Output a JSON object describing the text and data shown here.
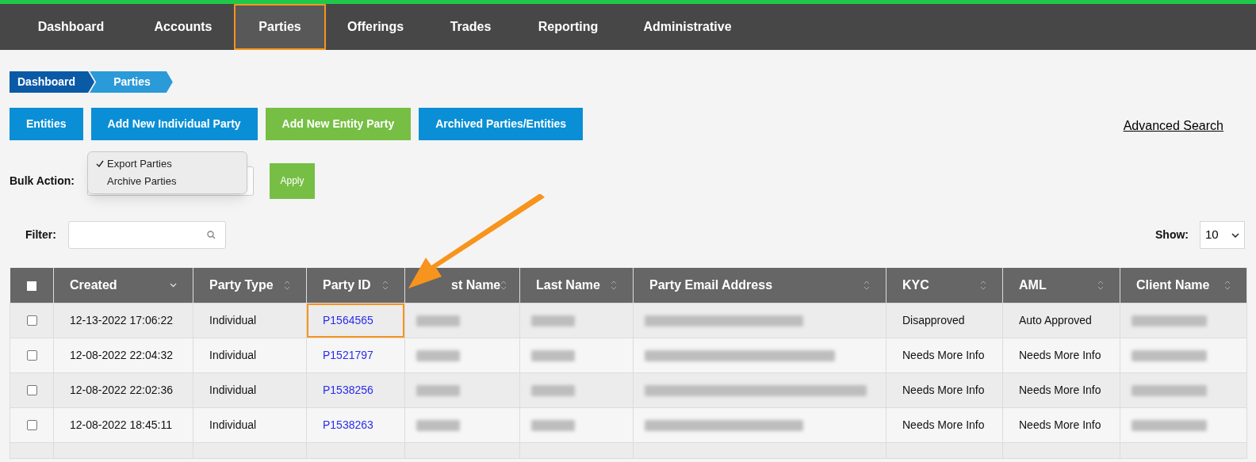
{
  "nav": [
    {
      "label": "Dashboard",
      "selected": false,
      "highlighted": false
    },
    {
      "label": "Accounts",
      "selected": false,
      "highlighted": false
    },
    {
      "label": "Parties",
      "selected": true,
      "highlighted": true
    },
    {
      "label": "Offerings",
      "selected": false,
      "highlighted": false
    },
    {
      "label": "Trades",
      "selected": false,
      "highlighted": false
    },
    {
      "label": "Reporting",
      "selected": false,
      "highlighted": false
    },
    {
      "label": "Administrative",
      "selected": false,
      "highlighted": false
    }
  ],
  "breadcrumb": [
    "Dashboard",
    "Parties"
  ],
  "actions": [
    {
      "label": "Entities",
      "color": "#0a8fd6"
    },
    {
      "label": "Add New Individual Party",
      "color": "#0a8fd6"
    },
    {
      "label": "Add New Entity Party",
      "color": "#76bf44"
    },
    {
      "label": "Archived Parties/Entities",
      "color": "#0a8fd6"
    }
  ],
  "advanced_search": "Advanced Search",
  "bulk_action": {
    "label": "Bulk Action:",
    "options": [
      {
        "label": "Export Parties",
        "checked": true
      },
      {
        "label": "Archive Parties",
        "checked": false
      }
    ],
    "apply": "Apply"
  },
  "filter": {
    "label": "Filter:"
  },
  "show": {
    "label": "Show:",
    "value": "10"
  },
  "table": {
    "columns": [
      {
        "kind": "checkbox",
        "checked": false
      },
      {
        "label": "Created",
        "kind": "text",
        "sorted": true
      },
      {
        "label": "Party Type",
        "kind": "text",
        "sorted": false
      },
      {
        "label": "Party ID",
        "kind": "link",
        "sorted": false
      },
      {
        "label": "st Name",
        "kind": "redacted",
        "sorted": false
      },
      {
        "label": "Last Name",
        "kind": "redacted",
        "sorted": false
      },
      {
        "label": "Party Email Address",
        "kind": "redacted",
        "sorted": false
      },
      {
        "label": "KYC",
        "kind": "text",
        "sorted": false
      },
      {
        "label": "AML",
        "kind": "text",
        "sorted": false
      },
      {
        "label": "Client Name",
        "kind": "redacted",
        "sorted": false
      }
    ],
    "rows": [
      {
        "checked": false,
        "highlighted": true,
        "cells": [
          "",
          "12-13-2022 17:06:22",
          "Individual",
          "P1564565",
          "",
          "",
          "",
          "Disapproved",
          "Auto Approved",
          ""
        ]
      },
      {
        "checked": false,
        "highlighted": false,
        "cells": [
          "",
          "12-08-2022 22:04:32",
          "Individual",
          "P1521797",
          "",
          "",
          "",
          "Needs More Info",
          "Needs More Info",
          ""
        ]
      },
      {
        "checked": false,
        "highlighted": false,
        "cells": [
          "",
          "12-08-2022 22:02:36",
          "Individual",
          "P1538256",
          "",
          "",
          "",
          "Needs More Info",
          "Needs More Info",
          ""
        ]
      },
      {
        "checked": false,
        "highlighted": false,
        "cells": [
          "",
          "12-08-2022 18:45:11",
          "Individual",
          "P1538263",
          "",
          "",
          "",
          "Needs More Info",
          "Needs More Info",
          ""
        ]
      }
    ]
  }
}
